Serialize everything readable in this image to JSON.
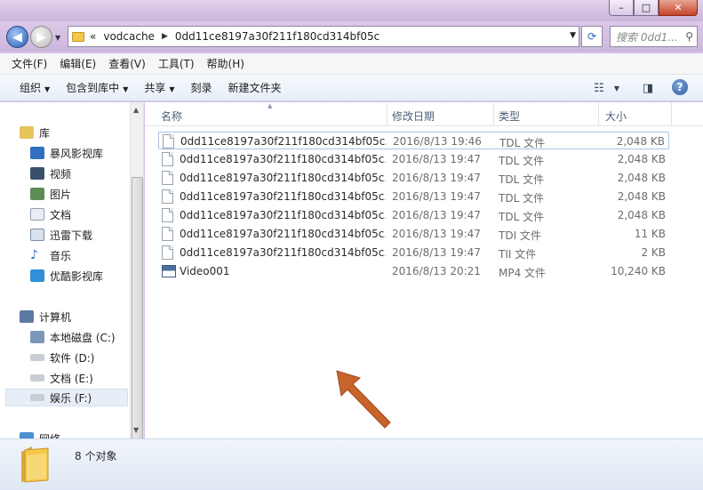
{
  "window": {
    "controls": {
      "minimize": "–",
      "maximize": "□",
      "close": "✕"
    }
  },
  "address": {
    "prefix": "«",
    "crumbs": [
      "vodcache",
      "0dd11ce8197a30f211f180cd314bf05c"
    ],
    "search_placeholder": "搜索 0dd1..."
  },
  "menu": [
    "文件(F)",
    "编辑(E)",
    "查看(V)",
    "工具(T)",
    "帮助(H)"
  ],
  "toolbar": {
    "organize": "组织",
    "include_library": "包含到库中",
    "share": "共享",
    "burn": "刻录",
    "new_folder": "新建文件夹"
  },
  "nav": {
    "libraries": "库",
    "library_items": [
      "暴风影视库",
      "视频",
      "图片",
      "文档",
      "迅雷下载",
      "音乐",
      "优酷影视库"
    ],
    "computer": "计算机",
    "drives": [
      "本地磁盘 (C:)",
      "软件 (D:)",
      "文档 (E:)",
      "娱乐 (F:)"
    ],
    "network": "网络"
  },
  "columns": {
    "name": "名称",
    "date": "修改日期",
    "type": "类型",
    "size": "大小"
  },
  "files": [
    {
      "name": "0dd11ce8197a30f211f180cd314bf05c...",
      "date": "2016/8/13 19:46",
      "type": "TDL 文件",
      "size": "2,048 KB",
      "icon": "file-icon"
    },
    {
      "name": "0dd11ce8197a30f211f180cd314bf05c...",
      "date": "2016/8/13 19:47",
      "type": "TDL 文件",
      "size": "2,048 KB",
      "icon": "file-icon"
    },
    {
      "name": "0dd11ce8197a30f211f180cd314bf05c...",
      "date": "2016/8/13 19:47",
      "type": "TDL 文件",
      "size": "2,048 KB",
      "icon": "file-icon"
    },
    {
      "name": "0dd11ce8197a30f211f180cd314bf05c...",
      "date": "2016/8/13 19:47",
      "type": "TDL 文件",
      "size": "2,048 KB",
      "icon": "file-icon"
    },
    {
      "name": "0dd11ce8197a30f211f180cd314bf05c...",
      "date": "2016/8/13 19:47",
      "type": "TDL 文件",
      "size": "2,048 KB",
      "icon": "file-icon"
    },
    {
      "name": "0dd11ce8197a30f211f180cd314bf05c...",
      "date": "2016/8/13 19:47",
      "type": "TDI 文件",
      "size": "11 KB",
      "icon": "file-icon"
    },
    {
      "name": "0dd11ce8197a30f211f180cd314bf05c...",
      "date": "2016/8/13 19:47",
      "type": "TII 文件",
      "size": "2 KB",
      "icon": "file-icon"
    },
    {
      "name": "Video001",
      "date": "2016/8/13 20:21",
      "type": "MP4 文件",
      "size": "10,240 KB",
      "icon": "mp4-icon"
    }
  ],
  "status": {
    "count": "8 个对象"
  },
  "colors": {
    "accent": "#2a5fb8",
    "arrow": "#c8632a",
    "folder": "#f3c84a"
  }
}
